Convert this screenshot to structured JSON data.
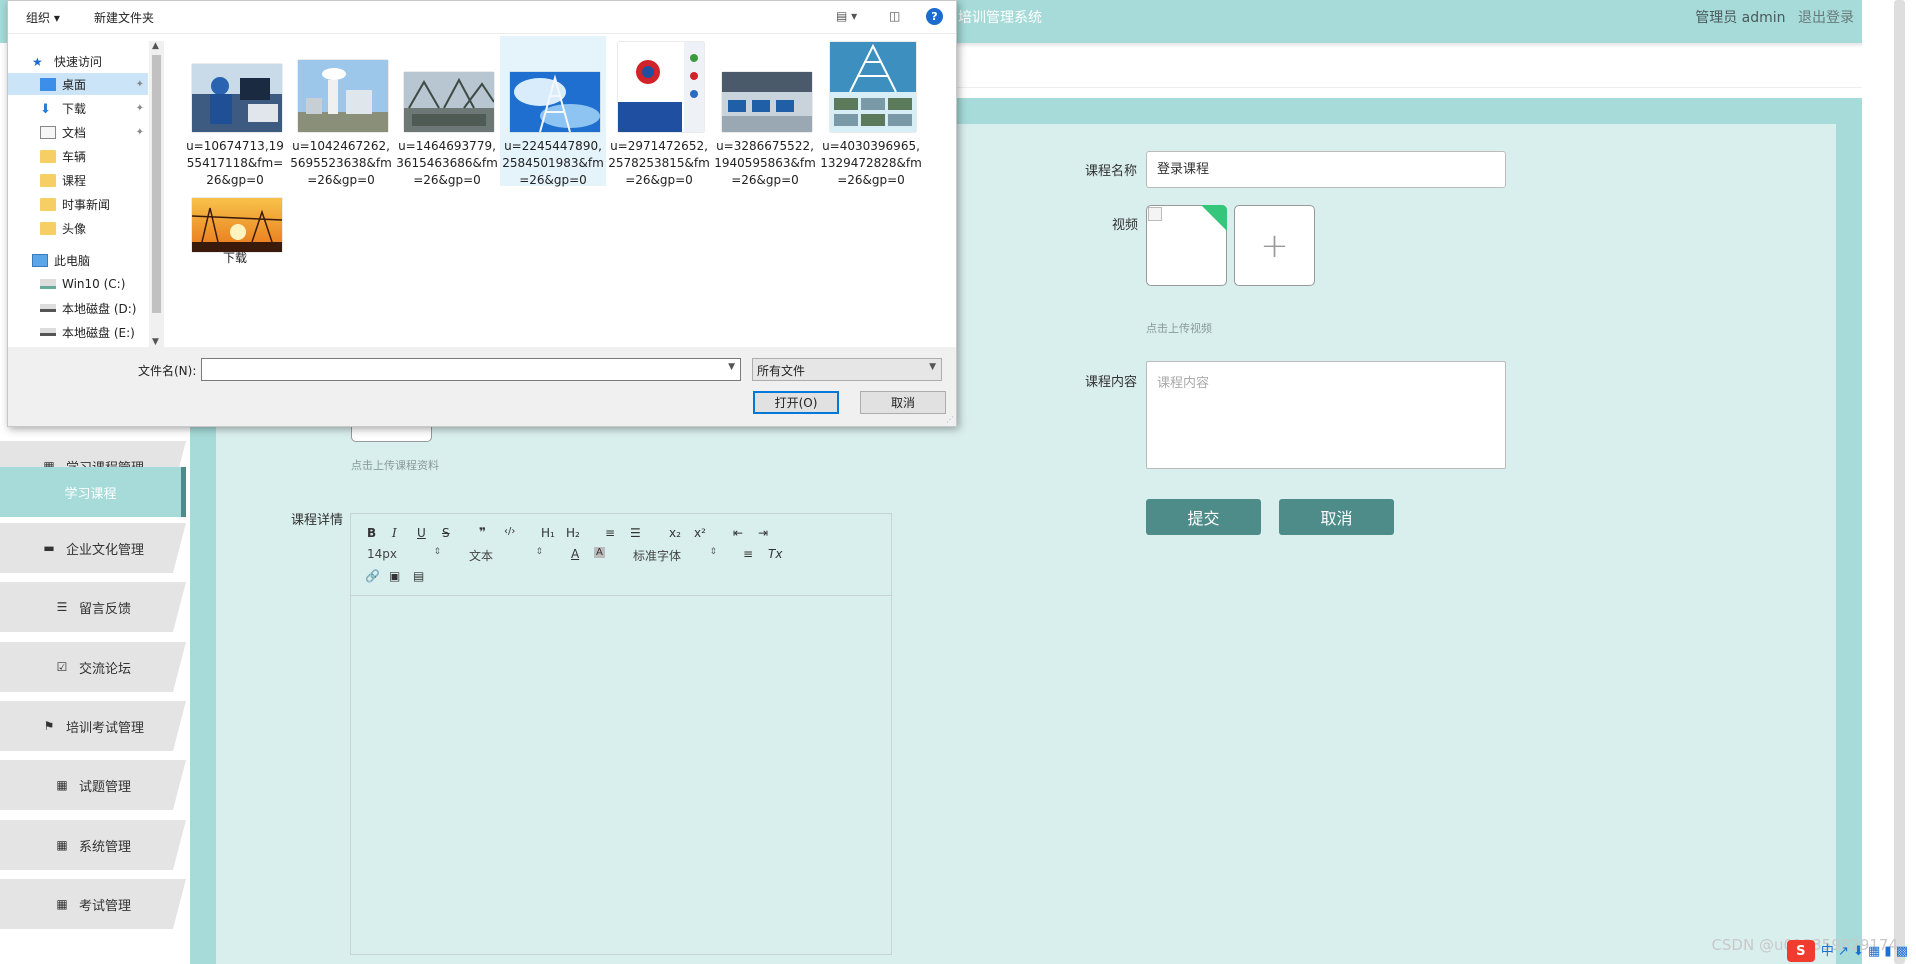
{
  "app": {
    "title": "培训管理系统",
    "user_label": "管理员 admin",
    "logout_label": "退出登录"
  },
  "sidebar": {
    "items": [
      {
        "label": "学习课程管理",
        "icon": "grid-icon",
        "active": false
      },
      {
        "label": "学习课程",
        "icon": "",
        "active": true
      },
      {
        "label": "企业文化管理",
        "icon": "monitor-icon",
        "active": false
      },
      {
        "label": "留言反馈",
        "icon": "list-icon",
        "active": false
      },
      {
        "label": "交流论坛",
        "icon": "check-square-icon",
        "active": false
      },
      {
        "label": "培训考试管理",
        "icon": "flag-icon",
        "active": false
      },
      {
        "label": "试题管理",
        "icon": "grid-icon",
        "active": false
      },
      {
        "label": "系统管理",
        "icon": "grid-icon",
        "active": false
      },
      {
        "label": "考试管理",
        "icon": "grid-icon",
        "active": false
      }
    ]
  },
  "form": {
    "course_name_label": "课程名称",
    "course_name_value": "登录课程",
    "video_label": "视频",
    "video_hint": "点击上传视频",
    "content_label": "课程内容",
    "content_placeholder": "课程内容",
    "material_hint": "点击上传课程资料",
    "detail_label": "课程详情",
    "submit_label": "提交",
    "cancel_label": "取消"
  },
  "editor": {
    "toolbar_row1": [
      "B",
      "I",
      "U",
      "S",
      "❞",
      "‹/›",
      "H₁",
      "H₂",
      "≡",
      "☰",
      "x₂",
      "x²",
      "⇤",
      "⇥"
    ],
    "font_size": "14px",
    "block_format": "文本",
    "font_family": "标准字体"
  },
  "dialog": {
    "toolbar": {
      "organize": "组织 ▾",
      "new_folder": "新建文件夹"
    },
    "nav": [
      {
        "label": "快速访问",
        "icon": "star-icon",
        "indent": 1,
        "pin": false,
        "selected": false
      },
      {
        "label": "桌面",
        "icon": "desktop-icon",
        "indent": 2,
        "pin": true,
        "selected": true
      },
      {
        "label": "下载",
        "icon": "download-icon",
        "indent": 2,
        "pin": true,
        "selected": false
      },
      {
        "label": "文档",
        "icon": "document-icon",
        "indent": 2,
        "pin": true,
        "selected": false
      },
      {
        "label": "车辆",
        "icon": "folder-icon",
        "indent": 2,
        "pin": false,
        "selected": false
      },
      {
        "label": "课程",
        "icon": "folder-icon",
        "indent": 2,
        "pin": false,
        "selected": false
      },
      {
        "label": "时事新闻",
        "icon": "folder-icon",
        "indent": 2,
        "pin": false,
        "selected": false
      },
      {
        "label": "头像",
        "icon": "folder-icon",
        "indent": 2,
        "pin": false,
        "selected": false
      },
      {
        "label": "此电脑",
        "icon": "computer-icon",
        "indent": 1,
        "pin": false,
        "selected": false
      },
      {
        "label": "Win10 (C:)",
        "icon": "drive-icon",
        "indent": 2,
        "pin": false,
        "selected": false
      },
      {
        "label": "本地磁盘 (D:)",
        "icon": "drive-icon",
        "indent": 2,
        "pin": false,
        "selected": false
      },
      {
        "label": "本地磁盘 (E:)",
        "icon": "drive-icon",
        "indent": 2,
        "pin": false,
        "selected": false
      }
    ],
    "files": [
      {
        "name": "u=10674713,1955417118&fm=26&gp=0",
        "thumb": "engineer-at-console",
        "colors": [
          "#2a4a7a",
          "#6e9fc4",
          "#e8e8e8"
        ]
      },
      {
        "name": "u=1042467262,5695523638&fm=26&gp=0",
        "thumb": "power-plant-sky",
        "colors": [
          "#9cc6ea",
          "#e6eef6",
          "#8a8f7a"
        ]
      },
      {
        "name": "u=1464693779,3615463686&fm=26&gp=0",
        "thumb": "substation",
        "colors": [
          "#b7c6d0",
          "#6d7876",
          "#3e4a44"
        ]
      },
      {
        "name": "u=2245447890,2584501983&fm=26&gp=0",
        "thumb": "pylon-blue-sky",
        "colors": [
          "#1e6fcf",
          "#8ec4f2",
          "#ffffff"
        ]
      },
      {
        "name": "u=2971472652,2578253815&fm=26&gp=0",
        "thumb": "brochure-logo",
        "colors": [
          "#ffffff",
          "#d1232a",
          "#1e4fa0"
        ]
      },
      {
        "name": "u=3286675522,1940595863&fm=26&gp=0",
        "thumb": "control-room",
        "colors": [
          "#4a5a6a",
          "#9aa8b4",
          "#c9d3dc"
        ]
      },
      {
        "name": "u=4030396965,1329472828&fm=26&gp=0",
        "thumb": "tower-poster",
        "colors": [
          "#3d8fbf",
          "#d7eef7",
          "#2a5d2a"
        ]
      },
      {
        "name": "下载",
        "thumb": "sunset-pylons",
        "colors": [
          "#e8761a",
          "#f7c24a",
          "#3a1a0a"
        ]
      }
    ],
    "filename_label": "文件名(N):",
    "filename_value": "",
    "filetype_value": "所有文件",
    "open_label": "打开(O)",
    "cancel_label": "取消"
  },
  "overlay": {
    "watermark": "CSDN @u013359829174"
  }
}
